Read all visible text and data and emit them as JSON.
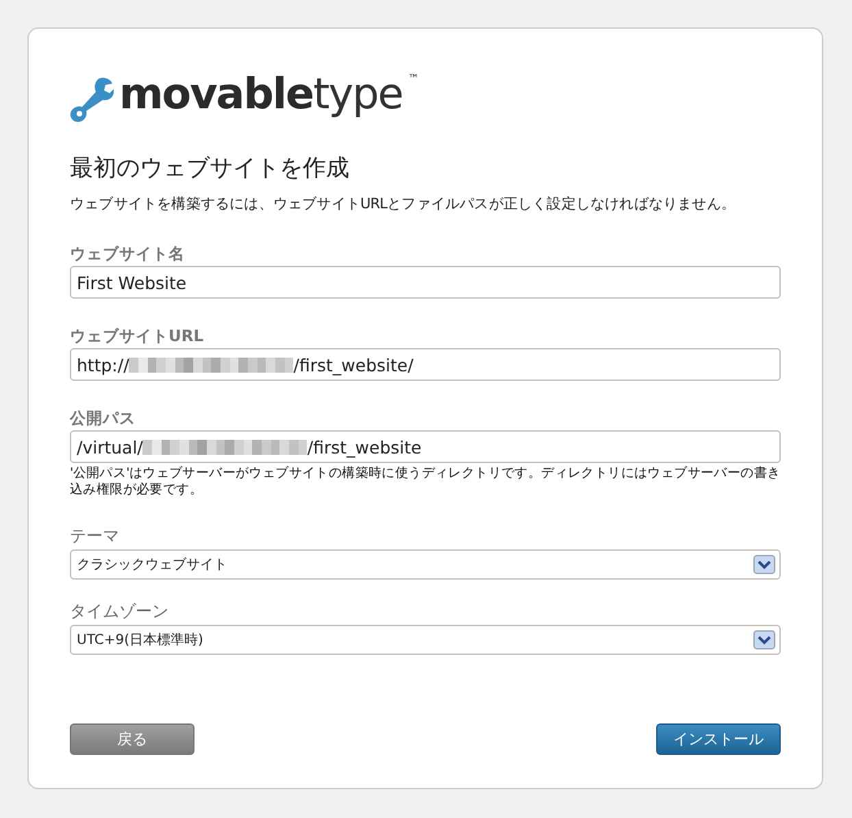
{
  "logo": {
    "text_bold": "movable",
    "text_light": "type",
    "trademark": "™"
  },
  "title": "最初のウェブサイトを作成",
  "description": "ウェブサイトを構築するには、ウェブサイトURLとファイルパスが正しく設定しなければなりません。",
  "fields": [
    {
      "kind": "text",
      "label": "ウェブサイト名",
      "value": "First Website"
    },
    {
      "kind": "text",
      "label": "ウェブサイトURL",
      "value": "http://",
      "redacted": true,
      "value_after": "/first_website/"
    },
    {
      "kind": "text",
      "label": "公開パス",
      "value": "/virtual/",
      "redacted": true,
      "value_after": "/first_website",
      "hint": "'公開パス'はウェブサーバーがウェブサイトの構築時に使うディレクトリです。ディレクトリにはウェブサーバーの書き込み権限が必要です。"
    },
    {
      "kind": "select",
      "label": "テーマ",
      "value": "クラシックウェブサイト"
    },
    {
      "kind": "select",
      "label": "タイムゾーン",
      "value": "UTC+9(日本標準時)"
    }
  ],
  "buttons": [
    {
      "kind": "secondary",
      "label": "戻る"
    },
    {
      "kind": "primary",
      "label": "インストール"
    }
  ]
}
